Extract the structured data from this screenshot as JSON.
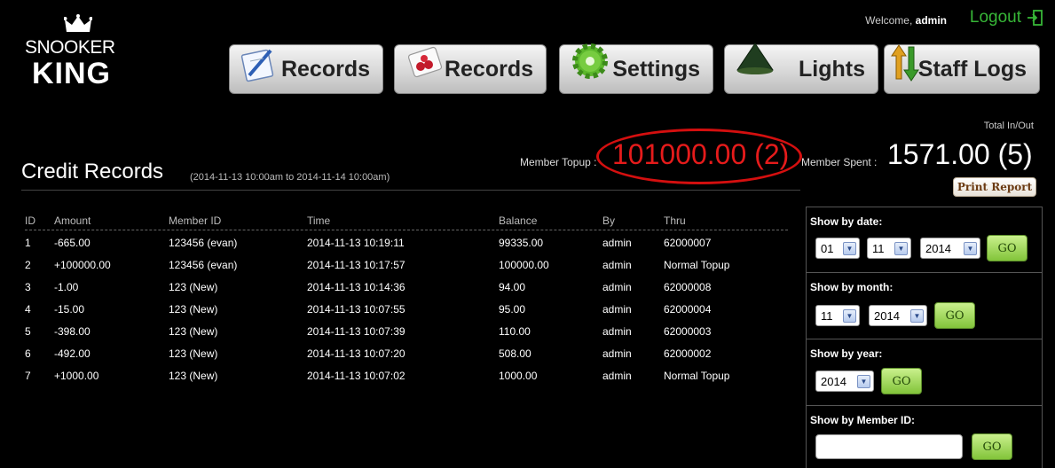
{
  "logo": {
    "line1": "SNOOKER",
    "line2": "KING"
  },
  "header": {
    "welcome_prefix": "Welcome,",
    "user": "admin",
    "logout_label": "Logout"
  },
  "nav": [
    {
      "label": "Records",
      "icon": "notepad-pen-icon"
    },
    {
      "label": "Records",
      "icon": "card-cherries-icon"
    },
    {
      "label": "Settings",
      "icon": "green-gear-icon"
    },
    {
      "label": "Lights",
      "icon": "lamp-shade-icon"
    },
    {
      "label": "Staff Logs",
      "icon": "up-down-arrows-icon"
    }
  ],
  "page": {
    "title": "Credit Records",
    "range": "(2014-11-13 10:00am to 2014-11-14 10:00am)",
    "total_label": "Total In/Out",
    "topup_label": "Member Topup :",
    "topup_value": "101000.00 (2)",
    "spent_label": "Member Spent :",
    "spent_value": "1571.00 (5)",
    "print_label": "Print Report"
  },
  "table": {
    "headers": [
      "ID",
      "Amount",
      "Member ID",
      "Time",
      "Balance",
      "By",
      "Thru"
    ],
    "rows": [
      [
        "1",
        "-665.00",
        "123456 (evan)",
        "2014-11-13 10:19:11",
        "99335.00",
        "admin",
        "62000007"
      ],
      [
        "2",
        "+100000.00",
        "123456 (evan)",
        "2014-11-13 10:17:57",
        "100000.00",
        "admin",
        "Normal Topup"
      ],
      [
        "3",
        "-1.00",
        "123 (New)",
        "2014-11-13 10:14:36",
        "94.00",
        "admin",
        "62000008"
      ],
      [
        "4",
        "-15.00",
        "123 (New)",
        "2014-11-13 10:07:55",
        "95.00",
        "admin",
        "62000004"
      ],
      [
        "5",
        "-398.00",
        "123 (New)",
        "2014-11-13 10:07:39",
        "110.00",
        "admin",
        "62000003"
      ],
      [
        "6",
        "-492.00",
        "123 (New)",
        "2014-11-13 10:07:20",
        "508.00",
        "admin",
        "62000002"
      ],
      [
        "7",
        "+1000.00",
        "123 (New)",
        "2014-11-13 10:07:02",
        "1000.00",
        "admin",
        "Normal Topup"
      ]
    ]
  },
  "filters": {
    "by_date": {
      "title": "Show by date:",
      "day": "01",
      "month": "11",
      "year": "2014",
      "go": "GO"
    },
    "by_month": {
      "title": "Show by month:",
      "month": "11",
      "year": "2014",
      "go": "GO"
    },
    "by_year": {
      "title": "Show by year:",
      "year": "2014",
      "go": "GO"
    },
    "by_member": {
      "title": "Show by Member ID:",
      "value": "",
      "go": "GO"
    }
  },
  "colors": {
    "accent_green": "#37b637",
    "topup_red": "#e51b1b",
    "go_green": "#82c43a"
  }
}
